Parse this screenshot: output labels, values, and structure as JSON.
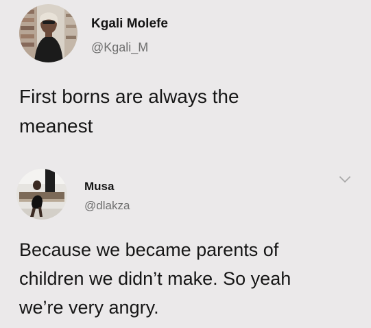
{
  "tweet": {
    "name": "Kgali Molefe",
    "handle": "@Kgali_M",
    "text_lines": [
      "First borns are always the",
      "meanest"
    ]
  },
  "reply": {
    "name": "Musa",
    "handle": "@dlakza",
    "text_lines": [
      "Because we became parents of",
      "children we didn’t make. So yeah",
      "we’re very angry."
    ]
  },
  "icons": {
    "menu": "chevron-down-icon"
  },
  "colors": {
    "background": "#ebe9ea",
    "text": "#161616",
    "handle": "#6e6e6e",
    "chevron": "#a9a9a9"
  }
}
